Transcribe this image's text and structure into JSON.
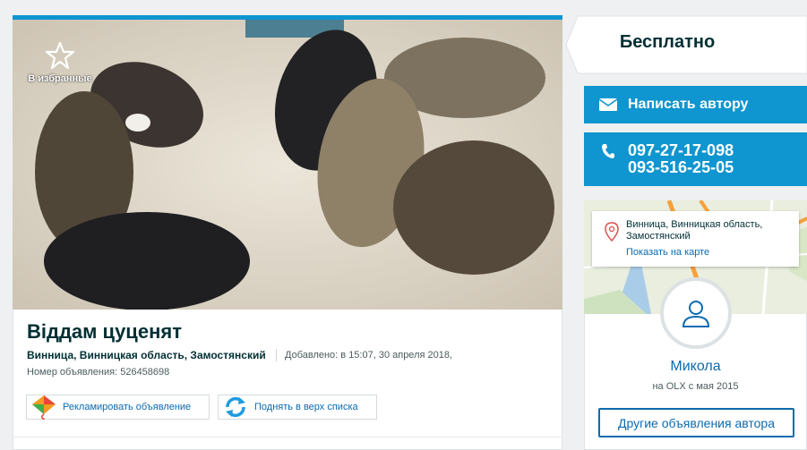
{
  "listing": {
    "favorite_label": "В избранные",
    "title": "Віддам цуценят",
    "location": "Винница, Винницкая область, Замостянский",
    "added": "Добавлено: в 15:07, 30 апреля 2018,",
    "ad_number": "Номер объявления: 526458698",
    "promote_label": "Рекламировать объявление",
    "raise_label": "Поднять в верх списка",
    "photo_icon": "puppies-photo"
  },
  "sidebar": {
    "price": "Бесплатно",
    "write_label": "Написать автору",
    "phones": [
      "097-27-17-098",
      "093-516-25-05"
    ],
    "map": {
      "address": "Винница, Винницкая область, Замостянский",
      "show_map_label": "Показать на карте"
    },
    "seller": {
      "name": "Микола",
      "since": "на OLX с мая 2015",
      "other_ads_label": "Другие объявления автора"
    }
  },
  "colors": {
    "accent": "#0f95cf",
    "link": "#0b6bb0",
    "text_dark": "#002f34"
  }
}
